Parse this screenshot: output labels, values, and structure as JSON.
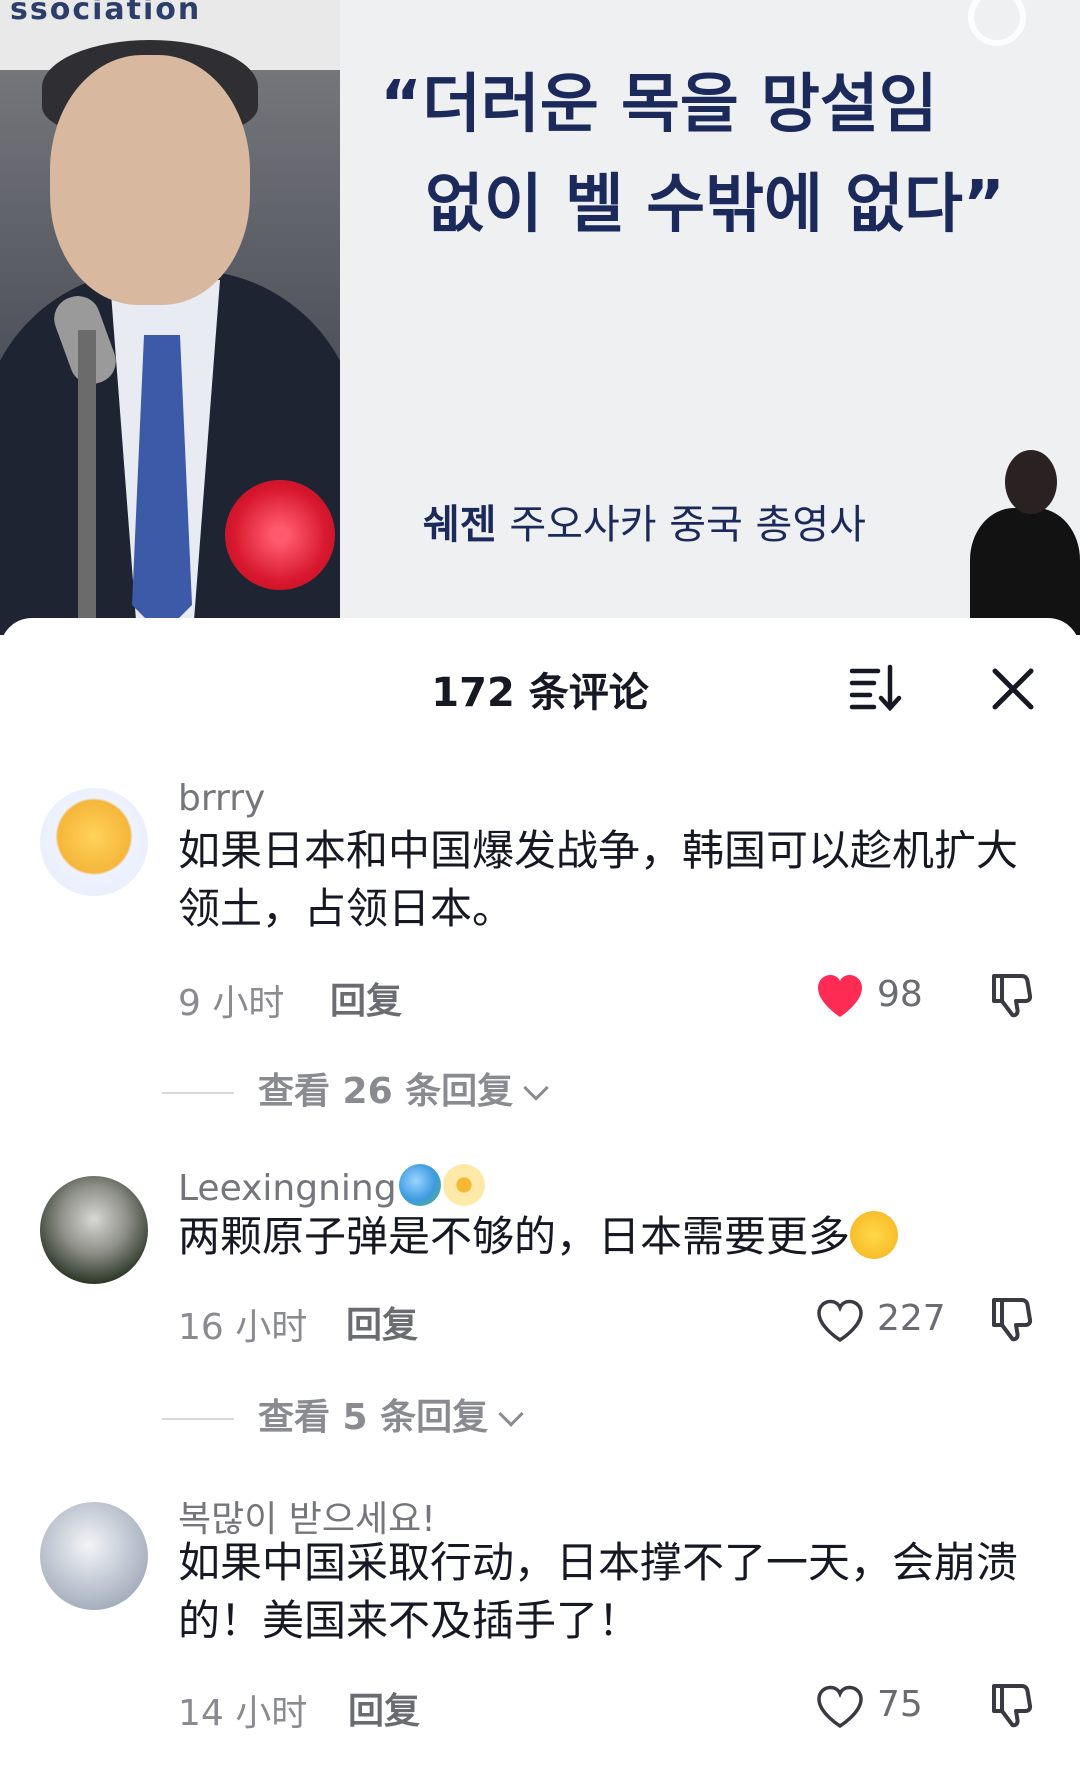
{
  "video": {
    "banner_text": "ssociation",
    "quote_line1": "“더러운 목을 망설임",
    "quote_line2": "없이 벨 수밖에 없다”",
    "speaker_name": "쉐젠",
    "speaker_title": "주오사카 중국 총영사"
  },
  "sheet": {
    "title": "172 条评论",
    "sort_icon": "sort-icon",
    "close_icon": "close-icon"
  },
  "comments": [
    {
      "username": "brrry",
      "text": "如果日本和中国爆发战争，韩国可以趁机扩大领土，占领日本。",
      "time": "9 小时",
      "reply_label": "回复",
      "likes": "98",
      "liked": true,
      "view_replies": "查看 26 条回复"
    },
    {
      "username": "Leexingning",
      "text": "两颗原子弹是不够的，日本需要更多",
      "time": "16 小时",
      "reply_label": "回复",
      "likes": "227",
      "liked": false,
      "view_replies": "查看 5 条回复"
    },
    {
      "username": "복많이 받으세요!",
      "text": "如果中国采取行动，日本撑不了一天，会崩溃的！美国来不及插手了！",
      "time": "14 小时",
      "reply_label": "回复",
      "likes": "75",
      "liked": false
    }
  ],
  "colors": {
    "like_active": "#fe2c55",
    "quote_text": "#1b2a5a",
    "secondary_text": "#8a8b91"
  }
}
